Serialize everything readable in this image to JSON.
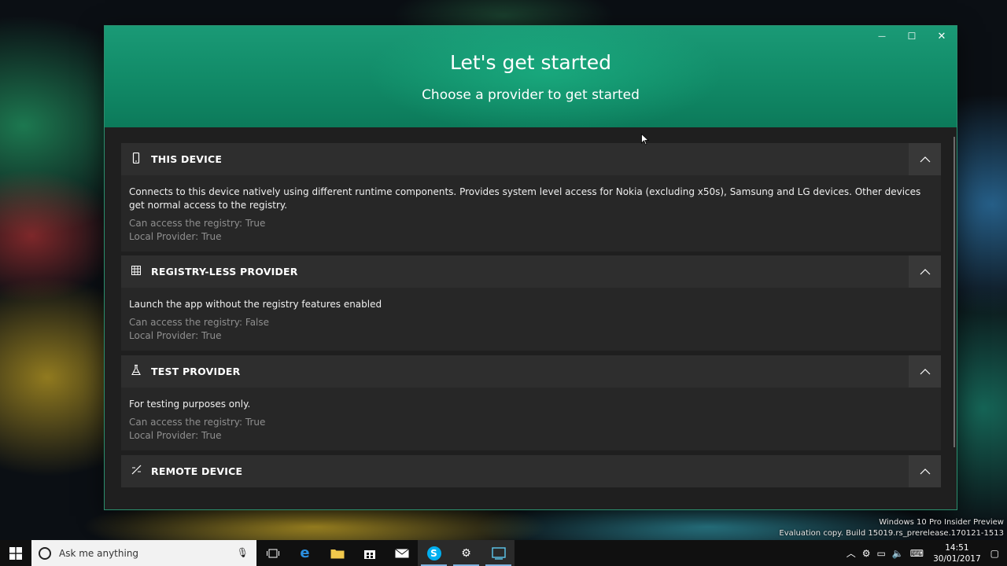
{
  "window": {
    "title": "Let's get started",
    "subtitle": "Choose a provider to get started",
    "controls": {
      "minimize": "—",
      "maximize": "☐",
      "close": "✕"
    }
  },
  "providers": [
    {
      "icon": "phone-icon",
      "title": "THIS DEVICE",
      "description": "Connects to this device natively using different runtime components. Provides system level access for Nokia (excluding x50s), Samsung and LG devices. Other devices get normal access to the registry.",
      "registry": "Can access the registry: True",
      "local": "Local Provider: True"
    },
    {
      "icon": "grid-icon",
      "title": "REGISTRY-LESS PROVIDER",
      "description": "Launch the app without the registry features enabled",
      "registry": "Can access the registry: False",
      "local": "Local Provider: True"
    },
    {
      "icon": "flask-icon",
      "title": "TEST PROVIDER",
      "description": "For testing purposes only.",
      "registry": "Can access the registry: True",
      "local": "Local Provider: True"
    },
    {
      "icon": "remote-icon",
      "title": "REMOTE DEVICE"
    }
  ],
  "taskbar": {
    "search_placeholder": "Ask me anything",
    "time": "14:51",
    "date": "30/01/2017"
  },
  "watermark": {
    "line1": "Windows 10 Pro Insider Preview",
    "line2": "Evaluation copy. Build 15019.rs_prerelease.170121-1513"
  }
}
